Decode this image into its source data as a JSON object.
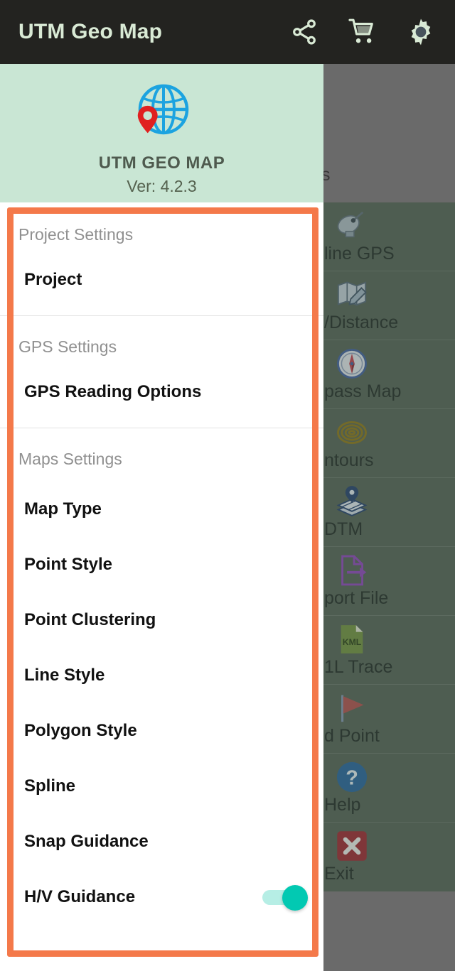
{
  "appbar": {
    "title": "UTM Geo Map",
    "actions": [
      {
        "name": "share-icon",
        "label": "Share"
      },
      {
        "name": "cart-icon",
        "label": "Store"
      },
      {
        "name": "gear-icon",
        "label": "Settings"
      }
    ]
  },
  "drawer_header": {
    "logo": "globe-pin-icon",
    "app_name": "UTM GEO MAP",
    "version": "Ver: 4.2.3"
  },
  "settings": {
    "sections": [
      {
        "header": "Project Settings",
        "items": [
          {
            "label": "Project",
            "toggle": null
          }
        ]
      },
      {
        "header": "GPS Settings",
        "items": [
          {
            "label": "GPS Reading Options",
            "toggle": null
          }
        ]
      },
      {
        "header": "Maps Settings",
        "items": [
          {
            "label": "Map Type",
            "toggle": null
          },
          {
            "label": "Point Style",
            "toggle": null
          },
          {
            "label": "Point Clustering",
            "toggle": null
          },
          {
            "label": "Line Style",
            "toggle": null
          },
          {
            "label": "Polygon Style",
            "toggle": null
          },
          {
            "label": "Spline",
            "toggle": null
          },
          {
            "label": "Snap Guidance",
            "toggle": null
          },
          {
            "label": "H/V Guidance",
            "toggle": "on"
          }
        ]
      }
    ]
  },
  "background_menu": {
    "clipped_top_label": "s",
    "items": [
      {
        "label": "line GPS",
        "full_label": "Offline GPS",
        "icon": "satellite-dish-icon"
      },
      {
        "label": "/Distance",
        "full_label": "Area/Distance",
        "icon": "map-pencil-icon"
      },
      {
        "label": "pass Map",
        "full_label": "Compass Map",
        "icon": "compass-icon"
      },
      {
        "label": "ntours",
        "full_label": "Contours",
        "icon": "contours-icon"
      },
      {
        "label": "DTM",
        "full_label": "DTM",
        "icon": "dtm-layers-icon"
      },
      {
        "label": "port File",
        "full_label": "Import File",
        "icon": "export-file-icon"
      },
      {
        "label": "1L Trace",
        "full_label": "KML Trace",
        "icon": "kml-file-icon"
      },
      {
        "label": "d Point",
        "full_label": "Find Point",
        "icon": "red-flag-icon"
      },
      {
        "label": "Help",
        "full_label": "Help",
        "icon": "help-circle-icon"
      },
      {
        "label": "Exit",
        "full_label": "Exit",
        "icon": "exit-close-icon"
      }
    ]
  },
  "colors": {
    "appbar_bg": "#232320",
    "appbar_text": "#d9ead5",
    "drawer_header_bg": "#c9e6d4",
    "highlight_border": "#f4794a",
    "toggle_on": "#02c9b2",
    "toggle_track": "#b6eee5",
    "scrim": "#6a6a6a",
    "bg_menu": "#4e5d51",
    "globe_blue": "#1ca3e0",
    "pin_red": "#e02020"
  }
}
